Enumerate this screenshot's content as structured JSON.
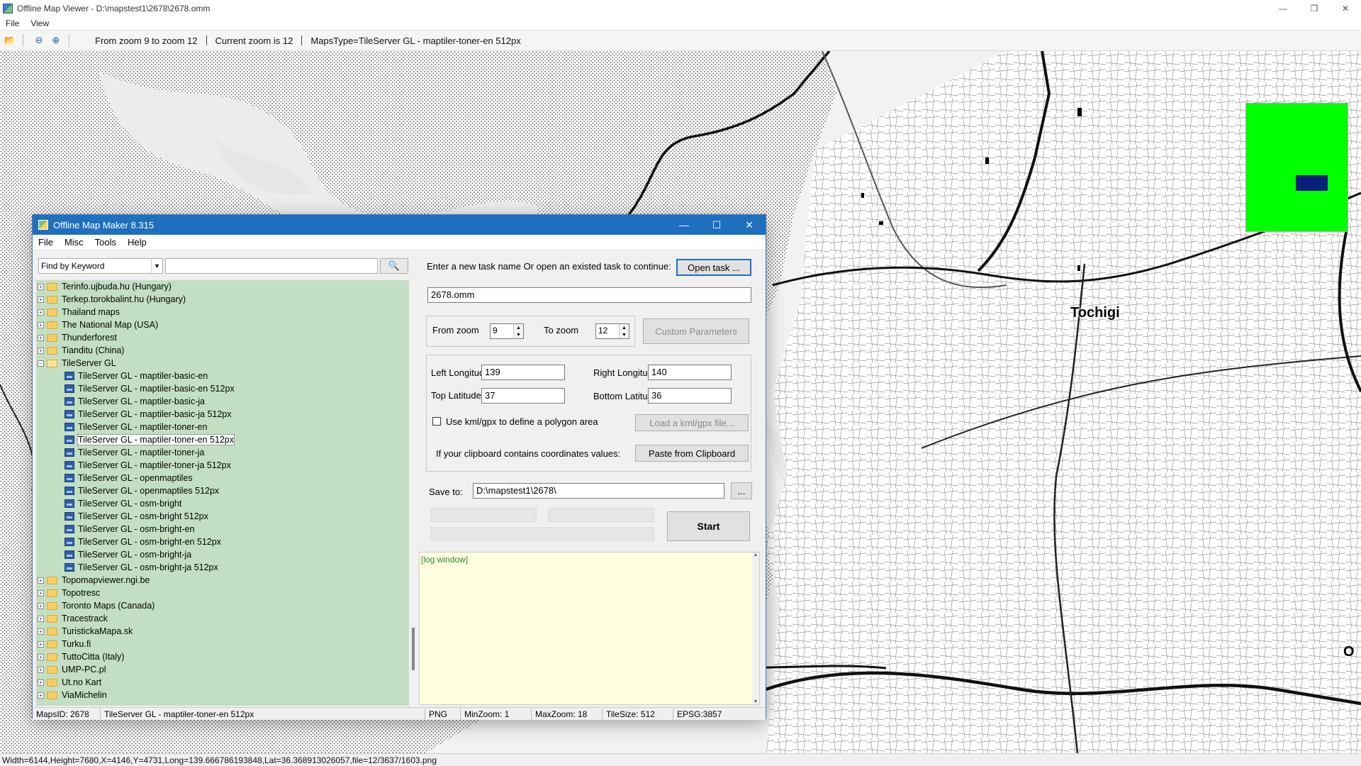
{
  "viewer": {
    "title": "Offline Map Viewer - D:\\mapstest1\\2678\\2678.omm",
    "menu": [
      "File",
      "View"
    ],
    "toolbar": {
      "zoom_range": "From zoom 9 to zoom 12",
      "current_zoom": "Current zoom is 12",
      "maps_type": "MapsType=TileServer GL - maptiler-toner-en 512px"
    },
    "status": "Width=6144,Height=7680,X=4146,Y=4731,Long=139.666786193848,Lat=36.368913026057,file=12/3637/1603.png",
    "map": {
      "city_label": "Tochigi",
      "edge_label": "O",
      "minimap_color": "#00ff00",
      "viewport_color": "#0a1f7a"
    }
  },
  "maker": {
    "title": "Offline Map Maker 8.315",
    "menu": [
      "File",
      "Misc",
      "Tools",
      "Help"
    ],
    "search": {
      "mode": "Find by Keyword",
      "value": ""
    },
    "tree": [
      {
        "label": "Terinfo.ujbuda.hu (Hungary)",
        "type": "folder"
      },
      {
        "label": "Terkep.torokbalint.hu (Hungary)",
        "type": "folder"
      },
      {
        "label": "Thailand maps",
        "type": "folder"
      },
      {
        "label": "The National Map (USA)",
        "type": "folder"
      },
      {
        "label": "Thunderforest",
        "type": "folder"
      },
      {
        "label": "Tianditu (China)",
        "type": "folder"
      },
      {
        "label": "TileServer GL",
        "type": "folder-open"
      },
      {
        "label": "TileServer GL - maptiler-basic-en",
        "type": "map"
      },
      {
        "label": "TileServer GL - maptiler-basic-en 512px",
        "type": "map"
      },
      {
        "label": "TileServer GL - maptiler-basic-ja",
        "type": "map"
      },
      {
        "label": "TileServer GL - maptiler-basic-ja 512px",
        "type": "map"
      },
      {
        "label": "TileServer GL - maptiler-toner-en",
        "type": "map"
      },
      {
        "label": "TileServer GL - maptiler-toner-en 512px",
        "type": "map",
        "selected": true
      },
      {
        "label": "TileServer GL - maptiler-toner-ja",
        "type": "map"
      },
      {
        "label": "TileServer GL - maptiler-toner-ja 512px",
        "type": "map"
      },
      {
        "label": "TileServer GL - openmaptiles",
        "type": "map"
      },
      {
        "label": "TileServer GL - openmaptiles 512px",
        "type": "map"
      },
      {
        "label": "TileServer GL - osm-bright",
        "type": "map"
      },
      {
        "label": "TileServer GL - osm-bright 512px",
        "type": "map"
      },
      {
        "label": "TileServer GL - osm-bright-en",
        "type": "map"
      },
      {
        "label": "TileServer GL - osm-bright-en 512px",
        "type": "map"
      },
      {
        "label": "TileServer GL - osm-bright-ja",
        "type": "map"
      },
      {
        "label": "TileServer GL - osm-bright-ja 512px",
        "type": "map"
      },
      {
        "label": "Topomapviewer.ngi.be",
        "type": "folder"
      },
      {
        "label": "Topotresc",
        "type": "folder"
      },
      {
        "label": "Toronto Maps (Canada)",
        "type": "folder"
      },
      {
        "label": "Tracestrack",
        "type": "folder"
      },
      {
        "label": "TuristickaMapa.sk",
        "type": "folder"
      },
      {
        "label": "Turku.fi",
        "type": "folder"
      },
      {
        "label": "TuttoCitta (Italy)",
        "type": "folder"
      },
      {
        "label": "UMP-PC.pl",
        "type": "folder"
      },
      {
        "label": "Ut.no Kart",
        "type": "folder"
      },
      {
        "label": "ViaMichelin",
        "type": "folder"
      }
    ],
    "task": {
      "prompt": "Enter a new task name Or open an existed task to continue:",
      "open_button": "Open task ...",
      "name": "2678.omm"
    },
    "zoom": {
      "from_label": "From zoom",
      "from_value": "9",
      "to_label": "To zoom",
      "to_value": "12",
      "custom_button": "Custom Parameters"
    },
    "coords": {
      "left_lon_label": "Left Longitude",
      "left_lon": "139",
      "right_lon_label": "Right Longitude",
      "right_lon": "140",
      "top_lat_label": "Top Latitude",
      "top_lat": "37",
      "bottom_lat_label": "Bottom Latitude",
      "bottom_lat": "36",
      "kml_label": "Use kml/gpx to define a polygon area",
      "kml_button": "Load a kml/gpx file...",
      "clipboard_label": "If your clipboard contains coordinates values:",
      "clipboard_button": "Paste from Clipboard"
    },
    "save": {
      "label": "Save to:",
      "path": "D:\\mapstest1\\2678\\",
      "browse": "..."
    },
    "start_button": "Start",
    "log": "[log window]",
    "status": {
      "maps_id": "MapsID: 2678",
      "maps_name": "TileServer GL - maptiler-toner-en 512px",
      "format": "PNG",
      "min_zoom": "MinZoom: 1",
      "max_zoom": "MaxZoom: 18",
      "tile_size": "TileSize: 512",
      "epsg": "EPSG:3857"
    }
  }
}
